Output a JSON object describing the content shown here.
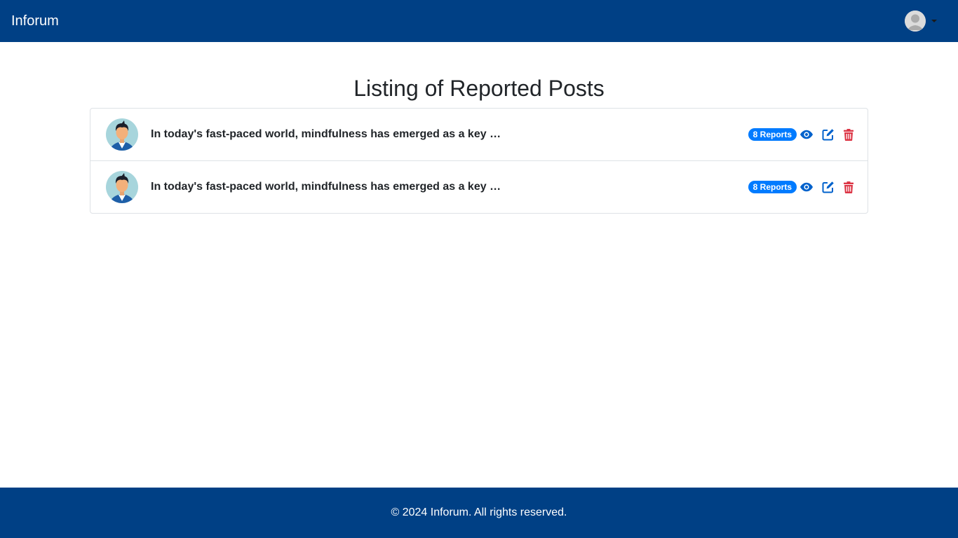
{
  "navbar": {
    "brand": "Inforum",
    "user_avatar_icon": "user-avatar-icon",
    "caret_icon": "caret-down-icon"
  },
  "page": {
    "title": "Listing of Reported Posts"
  },
  "posts": [
    {
      "text": "In today's fast-paced world, mindfulness has emerged as a key strategy for managing stress and improving mental health.",
      "reports": "8 Reports",
      "icons": [
        "eye-icon",
        "edit-icon",
        "trash-icon"
      ]
    },
    {
      "text": "In today's fast-paced world, mindfulness has emerged as a key strategy for managing stress and improving mental health.",
      "reports": "8 Reports",
      "icons": [
        "eye-icon",
        "edit-icon",
        "trash-icon"
      ]
    }
  ],
  "colors": {
    "primary": "#004085",
    "badge": "#007bff",
    "view_icon": "#0062cc",
    "edit_icon": "#0062cc",
    "delete_icon": "#dc3545"
  },
  "footer": {
    "text": "© 2024 Inforum. All rights reserved."
  }
}
